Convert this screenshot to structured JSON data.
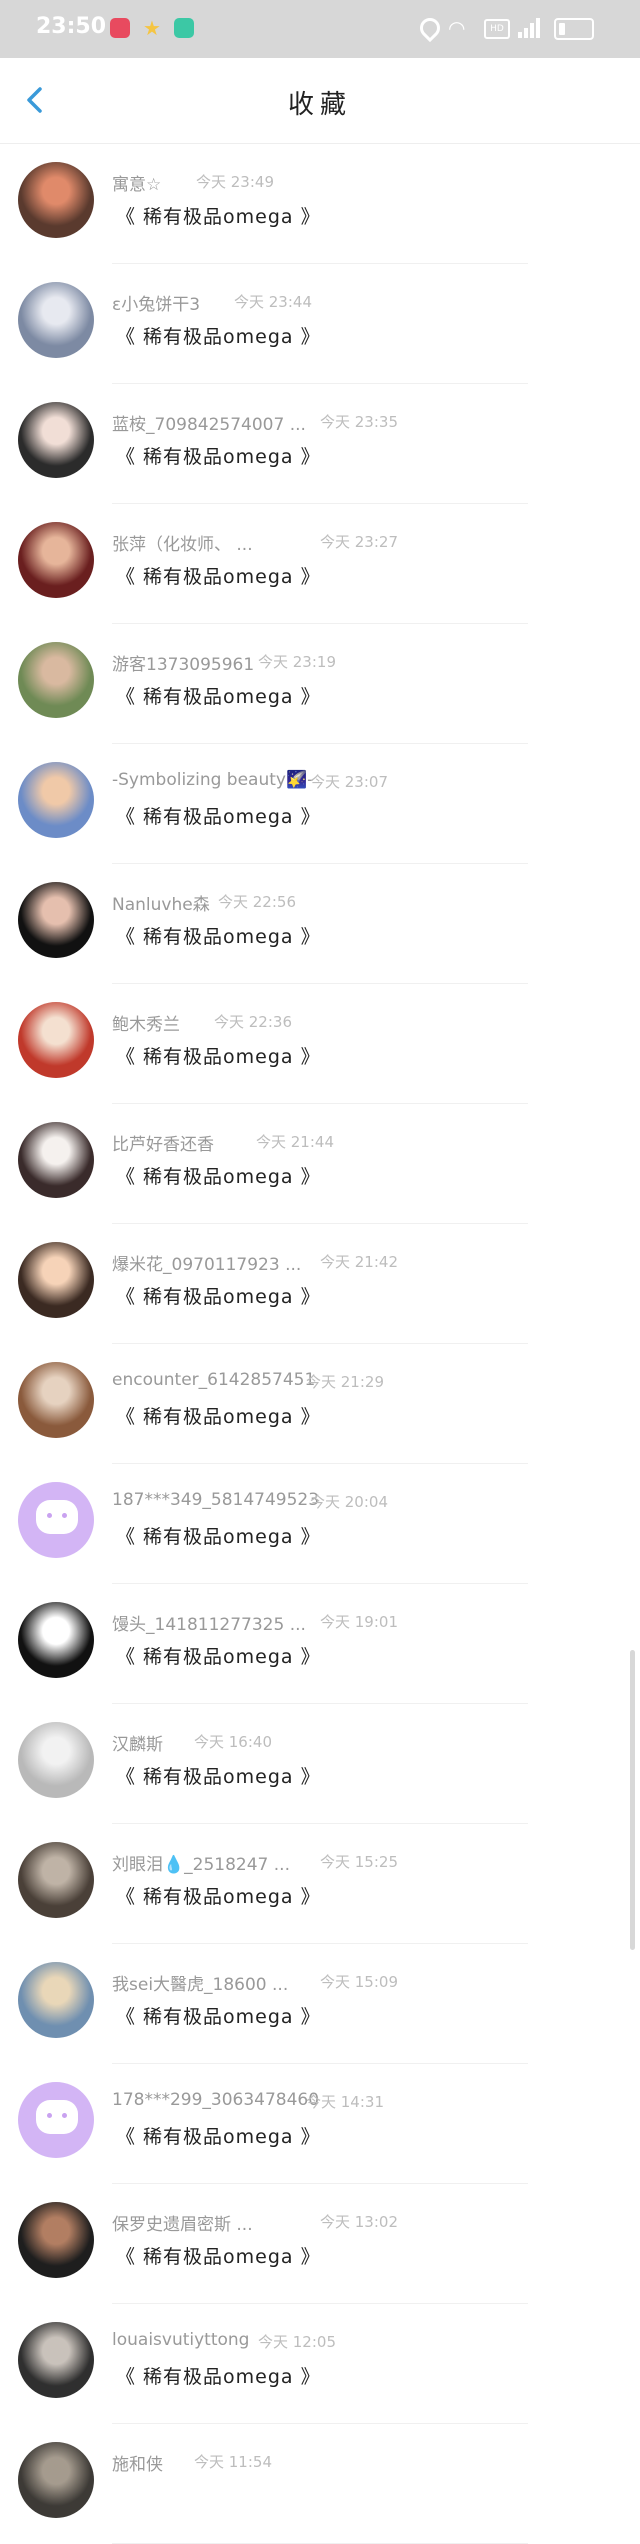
{
  "status_bar": {
    "time": "23:50",
    "hd_label": "HD",
    "icons": [
      "app-icon-red",
      "star-icon",
      "app-icon-green",
      "location-icon",
      "wifi-icon",
      "signal-icon",
      "battery-icon"
    ]
  },
  "header": {
    "title": "收藏",
    "back_icon": "chevron-left-icon"
  },
  "colors": {
    "accent": "#3a9ad9",
    "name": "#999999",
    "time": "#bdbdbd",
    "message": "#222222",
    "default_avatar": "#d3b5f5"
  },
  "items": [
    {
      "name": "寓意☆",
      "time": "今天 23:49",
      "message": "《 稀有极品omega 》",
      "avatar": "photo",
      "c1": "#5a3a2e",
      "c2": "#e08a6a"
    },
    {
      "name": "ε小兔饼干3",
      "time": "今天 23:44",
      "message": "《 稀有极品omega 》",
      "avatar": "photo",
      "c1": "#7d8aa3",
      "c2": "#e7e9f0"
    },
    {
      "name": "蓝桉_709842574007 ...",
      "time": "今天 23:35",
      "message": "《 稀有极品omega 》",
      "avatar": "photo",
      "c1": "#2b2b2b",
      "c2": "#f1ded6"
    },
    {
      "name": "张萍（化妆师、 ...",
      "time": "今天 23:27",
      "message": "《 稀有极品omega 》",
      "avatar": "photo",
      "c1": "#6a1f1f",
      "c2": "#e6b59a"
    },
    {
      "name": "游客1373095961",
      "time": "今天 23:19",
      "message": "《 稀有极品omega 》",
      "avatar": "photo",
      "c1": "#6f8a55",
      "c2": "#d9b9a0"
    },
    {
      "name": "-Symbolizing beauty🌠-",
      "time": "今天 23:07",
      "message": "《 稀有极品omega 》",
      "avatar": "photo",
      "c1": "#6c8cc7",
      "c2": "#f0c9a8"
    },
    {
      "name": "Nanluvhe森",
      "time": "今天 22:56",
      "message": "《 稀有极品omega 》",
      "avatar": "photo",
      "c1": "#111111",
      "c2": "#e5bfae"
    },
    {
      "name": "鲍木秀兰",
      "time": "今天 22:36",
      "message": "《 稀有极品omega 》",
      "avatar": "photo",
      "c1": "#c0392b",
      "c2": "#f4e0d0"
    },
    {
      "name": "比芦好香还香",
      "time": "今天 21:44",
      "message": "《 稀有极品omega 》",
      "avatar": "photo",
      "c1": "#3a2b2b",
      "c2": "#f5f1ee"
    },
    {
      "name": "爆米花_0970117923 ...",
      "time": "今天 21:42",
      "message": "《 稀有极品omega 》",
      "avatar": "photo",
      "c1": "#3b2a22",
      "c2": "#f6d3b8"
    },
    {
      "name": "encounter_6142857451",
      "time": "今天 21:29",
      "message": "《 稀有极品omega 》",
      "avatar": "photo",
      "c1": "#8a5a3c",
      "c2": "#e6d2c0"
    },
    {
      "name": "187***349_5814749523",
      "time": "今天 20:04",
      "message": "《 稀有极品omega 》",
      "avatar": "default",
      "c1": "#d3b5f5",
      "c2": "#d3b5f5"
    },
    {
      "name": "馒头_141811277325 ...",
      "time": "今天 19:01",
      "message": "《 稀有极品omega 》",
      "avatar": "photo",
      "c1": "#111111",
      "c2": "#ffffff"
    },
    {
      "name": "汉麟斯",
      "time": "今天 16:40",
      "message": "《 稀有极品omega 》",
      "avatar": "photo",
      "c1": "#b9b9b9",
      "c2": "#f2f2f2"
    },
    {
      "name": "刘眼泪💧_2518247 ...",
      "time": "今天 15:25",
      "message": "《 稀有极品omega 》",
      "avatar": "photo",
      "c1": "#4a4038",
      "c2": "#bfb3a6"
    },
    {
      "name": "我sei大醫虎_18600 ...",
      "time": "今天 15:09",
      "message": "《 稀有极品omega 》",
      "avatar": "photo",
      "c1": "#6f8fb0",
      "c2": "#e9d7b8"
    },
    {
      "name": "178***299_3063478460",
      "time": "今天 14:31",
      "message": "《 稀有极品omega 》",
      "avatar": "default",
      "c1": "#d3b5f5",
      "c2": "#d3b5f5"
    },
    {
      "name": "保罗史遗眉密斯 ...",
      "time": "今天 13:02",
      "message": "《 稀有极品omega 》",
      "avatar": "photo",
      "c1": "#1e1e1e",
      "c2": "#b27e62"
    },
    {
      "name": "louaisvutiyttong",
      "time": "今天 12:05",
      "message": "《 稀有极品omega 》",
      "avatar": "photo",
      "c1": "#2f2f2f",
      "c2": "#c9c2bb"
    },
    {
      "name": "施和侠",
      "time": "今天 11:54",
      "message": "",
      "avatar": "photo",
      "c1": "#3d3a36",
      "c2": "#a59b8e"
    }
  ]
}
